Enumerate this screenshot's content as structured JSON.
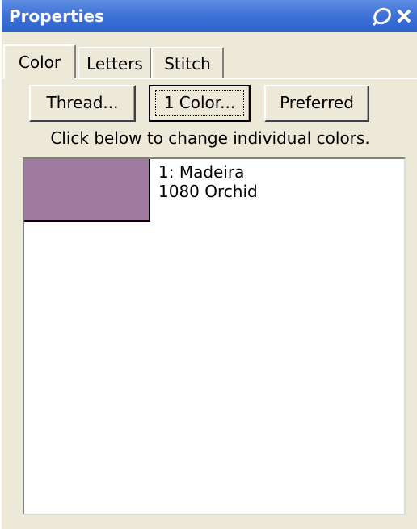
{
  "window": {
    "title": "Properties"
  },
  "tabs": [
    {
      "label": "Color",
      "selected": true
    },
    {
      "label": "Letters",
      "selected": false
    },
    {
      "label": "Stitch",
      "selected": false
    }
  ],
  "buttons": {
    "thread": "Thread...",
    "one_color": "1 Color...",
    "preferred": "Preferred"
  },
  "hint": "Click below to change individual colors.",
  "colors": [
    {
      "line1": "1: Madeira",
      "line2": "1080 Orchid",
      "swatch": "#a07aa0"
    }
  ],
  "theme": {
    "titlebar": "#3f73d6",
    "face": "#ece9d8"
  }
}
